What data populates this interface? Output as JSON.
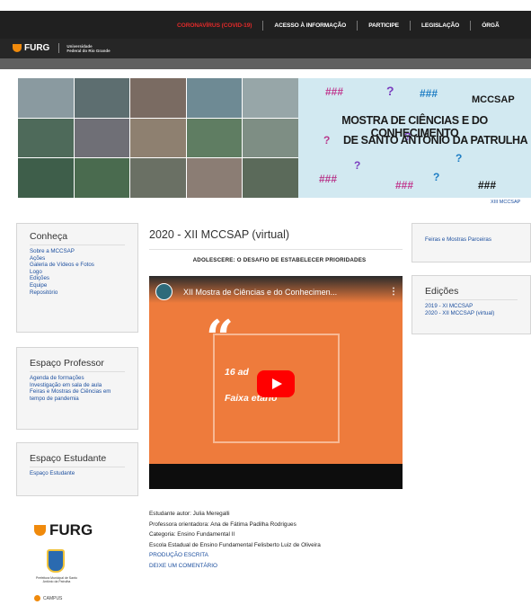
{
  "topnav": {
    "items": [
      "CORONAVÍRUS (COVID-19)",
      "ACESSO À INFORMAÇÃO",
      "PARTICIPE",
      "LEGISLAÇÃO",
      "ÓRGÃ"
    ]
  },
  "brand": {
    "logo_text": "FURG",
    "university_line1": "Universidade",
    "university_line2": "Federal do Rio Grande"
  },
  "banner": {
    "acronym": "MCCSAP",
    "title_line1": "MOSTRA DE CIÊNCIAS E DO CONHECIMENTO",
    "title_line2": "DE SANTO ANTÔNIO DA PATRULHA",
    "caption": "XIII MCCSAP"
  },
  "sidebar": {
    "conheca": {
      "title": "Conheça",
      "links": [
        "Sobre a MCCSAP",
        "Ações",
        "Galeria de Vídeos e Fotos",
        "Logo",
        "Edições",
        "Equipe",
        "Repositório"
      ]
    },
    "professor": {
      "title": "Espaço Professor",
      "links": [
        "Agenda de formações",
        "Investigação em sala de aula",
        "Feiras e Mostras de Ciências em tempo de pandemia"
      ]
    },
    "estudante": {
      "title": "Espaço Estudante",
      "links": [
        "Espaço Estudante"
      ]
    }
  },
  "right": {
    "parceiras": {
      "link": "Feiras e Mostras Parceiras"
    },
    "edicoes": {
      "title": "Edições",
      "links": [
        "2019 - XI MCCSAP",
        "2020 - XII MCCSAP (virtual)"
      ]
    }
  },
  "main": {
    "title": "2020 - XII MCCSAP (virtual)",
    "subtitle": "ADOLESCERE: O DESAFIO DE ESTABELECER PRIORIDADES",
    "video": {
      "title": "XII Mostra de Ciências e do Conhecimen...",
      "menu": "⋮",
      "quote": "“",
      "text1": "16 ad",
      "text2": "Faixa etário"
    },
    "info": [
      "Estudante autor: Julia Meregalli",
      "Professora orientadora: Ana de Fátima Padilha Rodrigues",
      "Categoria: Ensino Fundamental II",
      "Escola Estadual de Ensino Fundamental Felisberto Luiz de Oliveira"
    ],
    "links": [
      "PRODUÇÃO ESCRITA",
      "DEIXE UM COMENTÁRIO"
    ]
  },
  "footer_logos": {
    "furg": "FURG",
    "prefeitura": "Prefeitura Municipal de Santo Antônio da Patrulha",
    "campus": "CAMPUS"
  },
  "colors": {
    "topbar": "#202020",
    "covid": "#e02a2a",
    "link": "#1b4e9e",
    "video_bg": "#ee7b3c",
    "play": "#ff0000",
    "furg_orange": "#f08a0c"
  }
}
